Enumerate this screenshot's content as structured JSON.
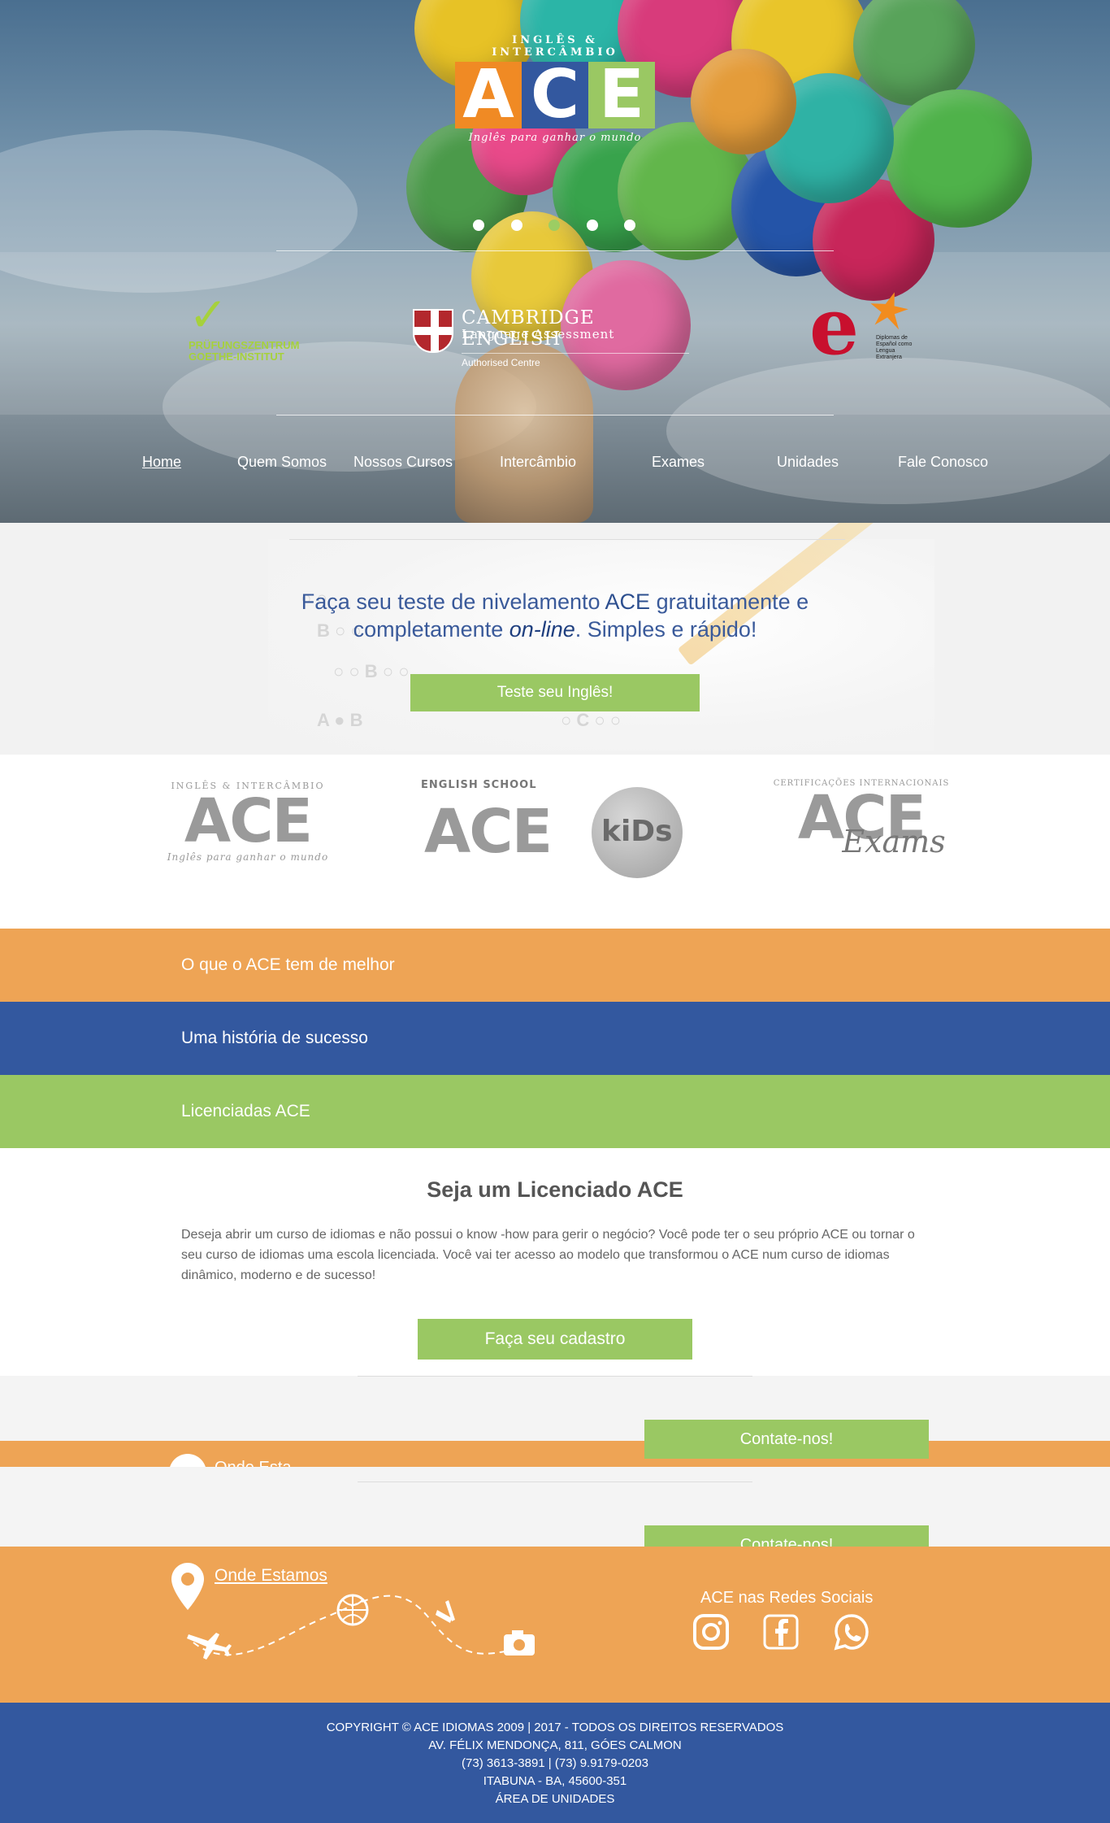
{
  "hero": {
    "logo": {
      "sup": "INGLÊS & INTERCÂMBIO",
      "letters": [
        "A",
        "C",
        "E"
      ],
      "tagline": "Inglês para ganhar o mundo",
      "letter_colors": [
        "#f08a24",
        "#33589f",
        "#9ac863"
      ]
    },
    "slider_dots": 5,
    "active_dot": 3,
    "partners": {
      "goethe": {
        "line1": "PRÜFUNGSZENTRUM",
        "line2": "GOETHE-INSTITUT"
      },
      "cambridge": {
        "line1": "CAMBRIDGE ENGLISH",
        "line2": "Language Assessment",
        "line3": "Authorised Centre"
      },
      "dele": {
        "letter": "e",
        "label": "Diplomas de Español como Lengua Extranjera"
      }
    }
  },
  "nav": {
    "items": [
      {
        "label": "Home",
        "current": true
      },
      {
        "label": "Quem Somos"
      },
      {
        "label": "Nossos Cursos"
      },
      {
        "label": "Intercâmbio"
      },
      {
        "label": "Exames"
      },
      {
        "label": "Unidades"
      },
      {
        "label": "Fale Conosco"
      }
    ]
  },
  "test": {
    "line1_pre": "Faça seu teste de nivelamento ",
    "line1_brand": "ACE",
    "line1_post": " gratuitamente e",
    "line2_pre": "completamente ",
    "line2_em": "on-line",
    "line2_post": ". Simples e rápido!",
    "button": "Teste seu Inglês!"
  },
  "brands": [
    {
      "sup": "INGLÊS & INTERCÂMBIO",
      "main": "ACE",
      "tag": "Inglês para ganhar o mundo"
    },
    {
      "sup": "ENGLISH SCHOOL",
      "main": "ACE",
      "tag": "kiDs"
    },
    {
      "sup": "CERTIFICAÇÕES INTERNACIONAIS",
      "main": "ACE",
      "tag": "Exams"
    }
  ],
  "bands": [
    {
      "label": "O que o ACE tem de melhor",
      "color": "#eea455"
    },
    {
      "label": "Uma história de sucesso",
      "color": "#33589f"
    },
    {
      "label": "Licenciadas ACE",
      "color": "#9ac863"
    }
  ],
  "licenciado": {
    "title": "Seja um Licenciado ACE",
    "text": "Deseja abrir um curso de idiomas e não possui o know -how para gerir o negócio? Você pode ter o seu próprio ACE ou tornar o seu curso de idiomas uma escola licenciada. Você vai ter acesso ao modelo que transformou o ACE num curso de idiomas dinâmico, moderno e de sucesso!",
    "button": "Faça seu cadastro"
  },
  "contact": {
    "button": "Contate-nos!",
    "clipped_label": "Onde Esta"
  },
  "footer": {
    "where_label": "Onde Estamos",
    "social_title": "ACE nas Redes Sociais",
    "social_icons": [
      "instagram-icon",
      "facebook-icon",
      "whatsapp-icon"
    ],
    "copyright": "COPYRIGHT © ACE IDIOMAS 2009 | 2017 - TODOS OS DIREITOS RESERVADOS",
    "address": "AV. FÉLIX MENDONÇA, 811, GÓES CALMON",
    "phones": "(73) 3613-3891 | (73) 9.9179-0203",
    "city": "ITABUNA - BA, 45600-351",
    "units_link": "ÁREA DE UNIDADES"
  }
}
